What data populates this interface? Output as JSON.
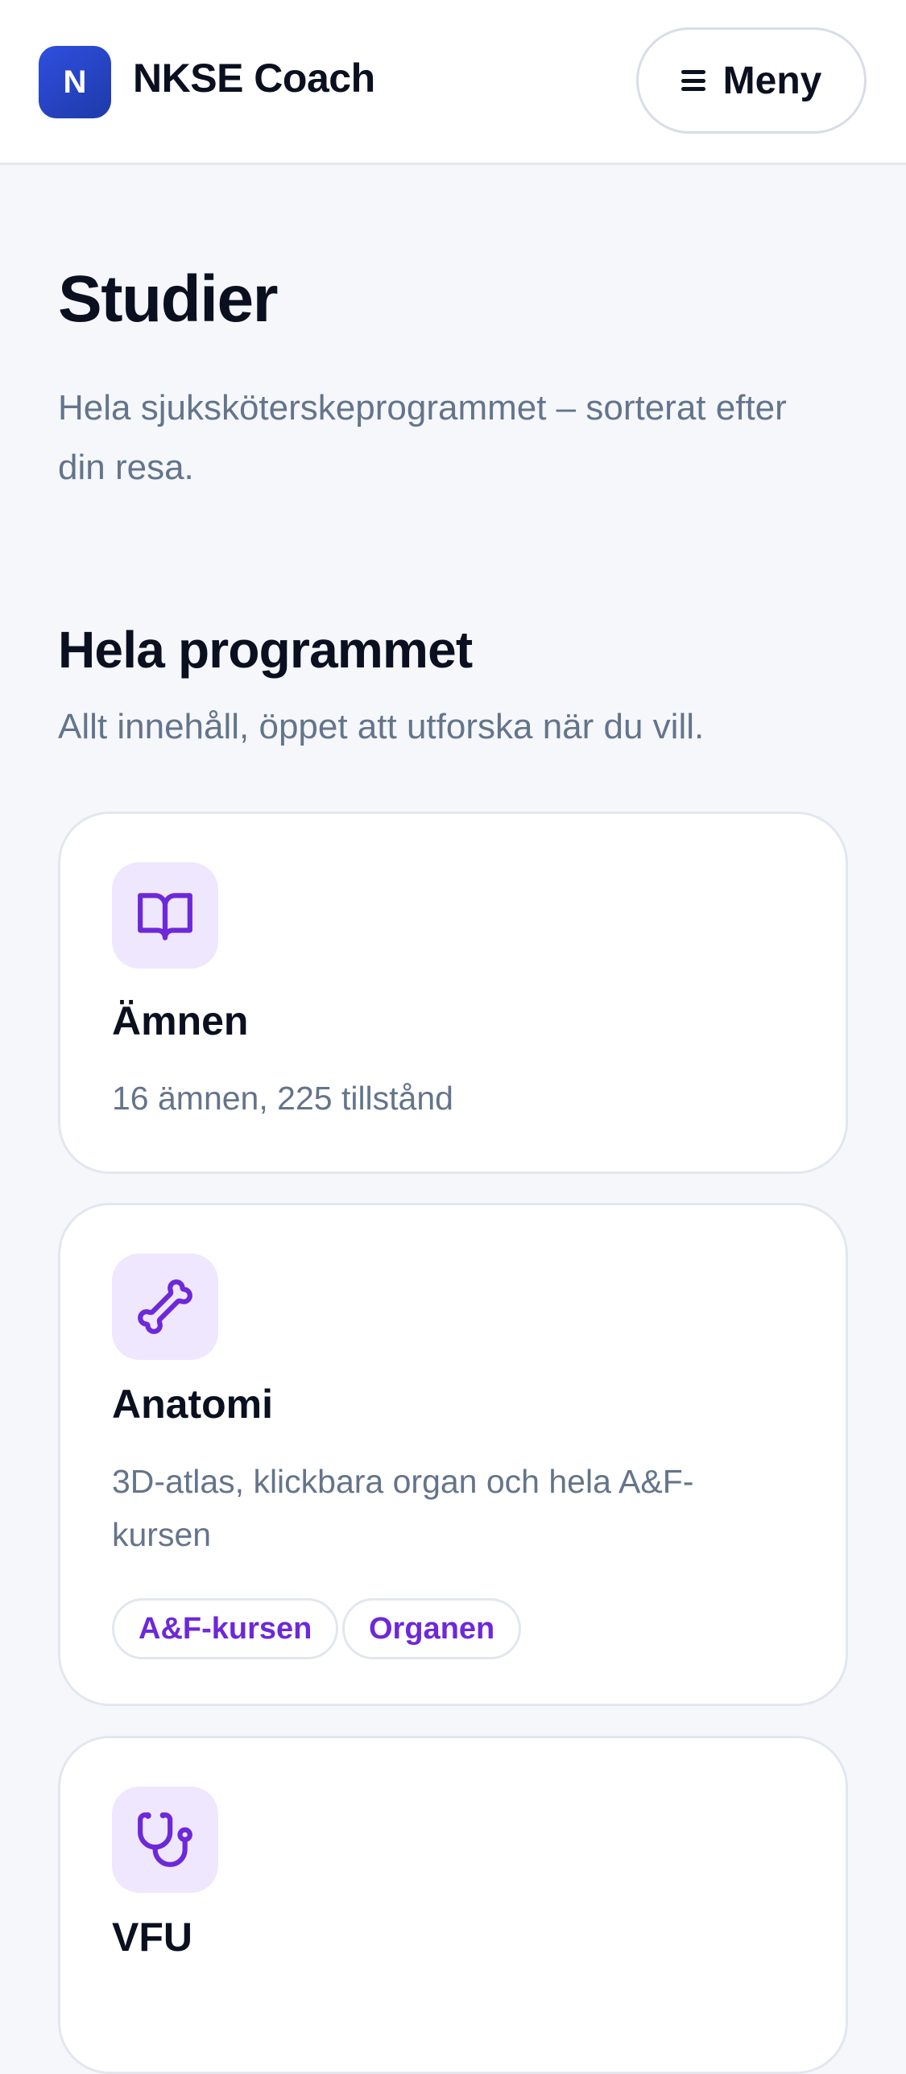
{
  "header": {
    "logo_letter": "N",
    "brand_name": "NKSE Coach",
    "menu_label": "Meny"
  },
  "page": {
    "title": "Studier",
    "subtitle": "Hela sjuksköterskeprogrammet – sorterat efter din resa."
  },
  "section": {
    "title": "Hela programmet",
    "subtitle": "Allt innehåll, öppet att utforska när du vill."
  },
  "cards": [
    {
      "icon": "book-icon",
      "title": "Ämnen",
      "description": "16 ämnen, 225 tillstånd",
      "chips": []
    },
    {
      "icon": "bone-icon",
      "title": "Anatomi",
      "description": "3D-atlas, klickbara organ och hela A&F-kursen",
      "chips": [
        "A&F-kursen",
        "Organen"
      ]
    },
    {
      "icon": "stethoscope-icon",
      "title": "VFU",
      "description": "",
      "chips": []
    }
  ],
  "colors": {
    "accent_purple": "#6d28d9",
    "icon_tile_bg": "#efe7fd",
    "brand_blue": "#2f4fe0",
    "muted_text": "#64748b",
    "background": "#f5f7fb"
  }
}
